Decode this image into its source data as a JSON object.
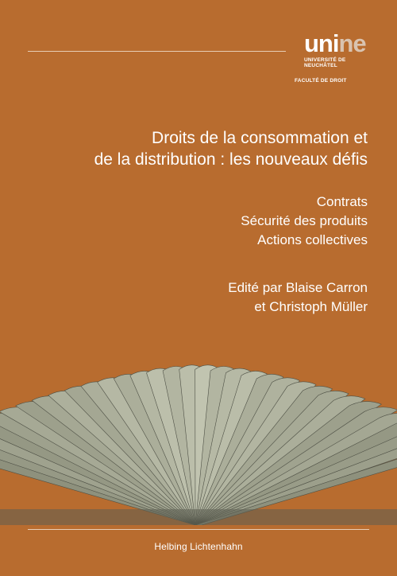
{
  "logo": {
    "wordmark_main": "uni",
    "wordmark_accent": "ne",
    "university_line1": "UNIVERSITÉ DE",
    "university_line2": "NEUCHÂTEL",
    "faculty": "FACULTÉ DE DROIT"
  },
  "title": {
    "line1": "Droits de la consommation et",
    "line2": "de la distribution : les nouveaux défis"
  },
  "topics": [
    "Contrats",
    "Sécurité des produits",
    "Actions collectives"
  ],
  "editors": {
    "line1": "Edité par Blaise Carron",
    "line2": "et Christoph Müller"
  },
  "publisher": "Helbing Lichtenhahn",
  "colors": {
    "background": "#b86c2f",
    "text": "#ffffff",
    "rule": "#e8cdb5"
  }
}
